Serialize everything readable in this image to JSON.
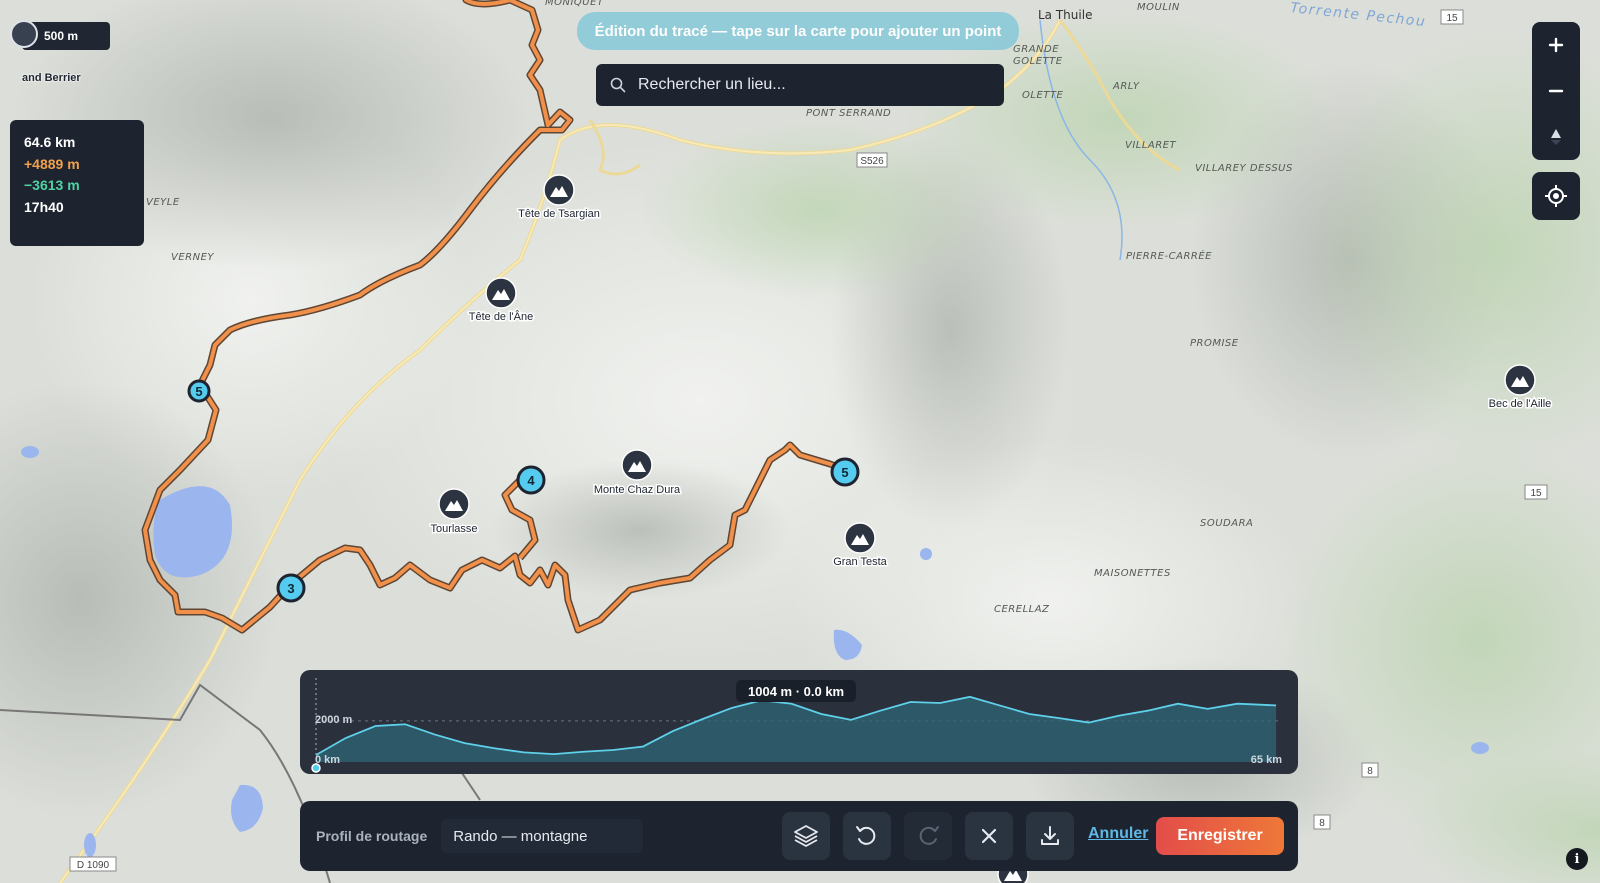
{
  "scale_bar": {
    "label": "500 m",
    "place": "and Berrier"
  },
  "stats": {
    "distance": "64.6 km",
    "ascent": "+4889 m",
    "descent": "−3613 m",
    "duration": "17h40"
  },
  "colors": {
    "ascent": "#f0a04b",
    "descent": "#4ed3a3",
    "route": "#f0904a",
    "waypoint": "#55cbef",
    "panel": "#1d2430",
    "accent_save": "#e94f47",
    "cancel_link": "#5fb8e6"
  },
  "banner": {
    "text": "Édition du tracé — tape sur la carte pour ajouter un point"
  },
  "search": {
    "placeholder": "Rechercher un lieu...",
    "icon": "search-icon"
  },
  "map_controls": {
    "zoom_in_icon": "plus-icon",
    "zoom_out_icon": "minus-icon",
    "compass_icon": "compass-icon",
    "locate_icon": "crosshair-icon"
  },
  "places": {
    "la_thuile": "La Thuile",
    "moulin": "MOULIN",
    "moniquet": "MONIQUET",
    "grande_golette": "GRANDE",
    "golette": "GOLETTE",
    "olette": "OLETTE",
    "arly": "ARLY",
    "villaret": "VILLARET",
    "villarey_dessus": "VILLAREY DESSUS",
    "pont_serrand": "PONT SERRAND",
    "pierre_carree": "PIERRE-CARRÉE",
    "promise": "PROMISE",
    "soudara": "SOUDARA",
    "maisonettes": "MAISONETTES",
    "cerellaz": "CERELLAZ",
    "veyle": "VEYLE",
    "verney": "VERNEY",
    "river": "Torrente Pechou"
  },
  "peaks": [
    "Tête de Tsargian",
    "Tête de l'Âne",
    "Monte Chaz Dura",
    "Tourlasse",
    "Gran Testa",
    "Bec de l'Aille"
  ],
  "road_shields": [
    "15",
    "S526",
    "15",
    "8",
    "8",
    "D 1090"
  ],
  "waypoints": [
    "3",
    "4",
    "5",
    "5"
  ],
  "elevation_profile": {
    "tooltip": "1004 m · 0.0 km",
    "y_label": "2000 m",
    "x_start": "0 km",
    "x_end": "65 km",
    "chart_data": {
      "type": "area",
      "xlabel": "",
      "ylabel": "",
      "x": [
        0,
        2,
        4,
        6,
        8,
        10,
        12,
        14,
        16,
        18,
        20,
        22,
        24,
        26,
        28,
        30,
        32,
        34,
        36,
        38,
        40,
        42,
        44,
        46,
        48,
        50,
        52,
        54,
        56,
        58,
        60,
        62,
        64.6
      ],
      "y": [
        1004,
        1500,
        1850,
        1900,
        1600,
        1350,
        1200,
        1080,
        1030,
        1100,
        1150,
        1250,
        1700,
        2050,
        2380,
        2600,
        2500,
        2200,
        2030,
        2300,
        2550,
        2520,
        2700,
        2450,
        2200,
        2080,
        1950,
        2150,
        2300,
        2500,
        2350,
        2500,
        2450
      ],
      "xlim": [
        0,
        65
      ]
    }
  },
  "toolbar": {
    "routing_label": "Profil de routage",
    "routing_value": "Rando — montagne",
    "layers_icon": "layers-icon",
    "undo_icon": "undo-icon",
    "redo_icon": "redo-icon",
    "clear_icon": "close-icon",
    "export_icon": "download-icon",
    "cancel_label": "Annuler",
    "save_label": "Enregistrer"
  },
  "info_glyph": "i"
}
